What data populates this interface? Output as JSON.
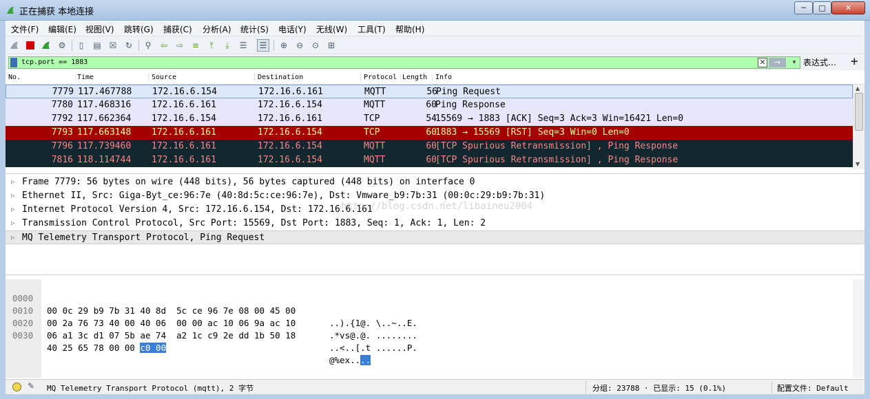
{
  "window": {
    "title": "正在捕获 本地连接",
    "min": "─",
    "max": "□",
    "close": "✕"
  },
  "menu": [
    "文件(F)",
    "编辑(E)",
    "视图(V)",
    "跳转(G)",
    "捕获(C)",
    "分析(A)",
    "统计(S)",
    "电话(Y)",
    "无线(W)",
    "工具(T)",
    "帮助(H)"
  ],
  "toolbar": {
    "icons": [
      "shark-fin-icon",
      "stop-icon",
      "restart-icon",
      "options-icon",
      "open-icon",
      "save-icon",
      "close-file-icon",
      "reload-icon",
      "find-icon",
      "back-icon",
      "forward-icon",
      "goto-icon",
      "first-icon",
      "last-icon",
      "autoscroll-icon",
      "colorize-icon",
      "zoom-in-icon",
      "zoom-out-icon",
      "zoom-normal-icon",
      "resize-columns-icon"
    ]
  },
  "filter": {
    "value": "tcp.port == 1883",
    "expression_label": "表达式…",
    "add_label": "+",
    "dropdown": "▾",
    "apply": "→",
    "clear": "✕"
  },
  "columns": {
    "no": "No.",
    "time": "Time",
    "source": "Source",
    "destination": "Destination",
    "protocol": "Protocol",
    "length": "Length",
    "info": "Info"
  },
  "packets": [
    {
      "no": "7779",
      "time": "117.467788",
      "src": "172.16.6.154",
      "dst": "172.16.6.161",
      "proto": "MQTT",
      "len": "56",
      "info": "Ping Request",
      "bg": "#dce8fa",
      "fg": "#000000"
    },
    {
      "no": "7780",
      "time": "117.468316",
      "src": "172.16.6.161",
      "dst": "172.16.6.154",
      "proto": "MQTT",
      "len": "60",
      "info": "Ping Response",
      "bg": "#e7e6ff",
      "fg": "#000000"
    },
    {
      "no": "7792",
      "time": "117.662364",
      "src": "172.16.6.154",
      "dst": "172.16.6.161",
      "proto": "TCP",
      "len": "54",
      "info": "15569 → 1883 [ACK] Seq=3 Ack=3 Win=16421 Len=0",
      "bg": "#e7e6ff",
      "fg": "#000000"
    },
    {
      "no": "7793",
      "time": "117.663148",
      "src": "172.16.6.161",
      "dst": "172.16.6.154",
      "proto": "TCP",
      "len": "60",
      "info": "1883 → 15569 [RST] Seq=3 Win=0 Len=0",
      "bg": "#a40000",
      "fg": "#fffc9c"
    },
    {
      "no": "7796",
      "time": "117.739460",
      "src": "172.16.6.161",
      "dst": "172.16.6.154",
      "proto": "MQTT",
      "len": "60",
      "info": "[TCP Spurious Retransmission] , Ping Response",
      "bg": "#12272e",
      "fg": "#f78787"
    },
    {
      "no": "7816",
      "time": "118.114744",
      "src": "172.16.6.161",
      "dst": "172.16.6.154",
      "proto": "MQTT",
      "len": "60",
      "info": "[TCP Spurious Retransmission] , Ping Response",
      "bg": "#12272e",
      "fg": "#f78787"
    }
  ],
  "details": [
    "Frame 7779: 56 bytes on wire (448 bits), 56 bytes captured (448 bits) on interface 0",
    "Ethernet II, Src: Giga-Byt_ce:96:7e (40:8d:5c:ce:96:7e), Dst: Vmware_b9:7b:31 (00:0c:29:b9:7b:31)",
    "Internet Protocol Version 4, Src: 172.16.6.154, Dst: 172.16.6.161",
    "Transmission Control Protocol, Src Port: 15569, Dst Port: 1883, Seq: 1, Ack: 1, Len: 2",
    "MQ Telemetry Transport Protocol, Ping Request"
  ],
  "watermark": "http://blog.csdn.net/libaineu2004",
  "bytes": [
    {
      "off": "0000",
      "hex": "00 0c 29 b9 7b 31 40 8d  5c ce 96 7e 08 00 45 00",
      "ascii": "..).{1@. \\..~..E."
    },
    {
      "off": "0010",
      "hex": "00 2a 76 73 40 00 40 06  00 00 ac 10 06 9a ac 10",
      "ascii": ".*vs@.@. ........"
    },
    {
      "off": "0020",
      "hex": "06 a1 3c d1 07 5b ae 74  a2 1c c9 2e dd 1b 50 18",
      "ascii": "..<..[.t ......P."
    },
    {
      "off": "0030",
      "hex_plain": "40 25 65 78 00 00 ",
      "hex_hl": "c0 00",
      "ascii_plain": "@%ex..",
      "ascii_hl": ".."
    }
  ],
  "status": {
    "left": "MQ Telemetry Transport Protocol (mqtt), 2 字节",
    "middle": "分组: 23788 · 已显示: 15 (0.1%)",
    "right": "配置文件: Default"
  }
}
